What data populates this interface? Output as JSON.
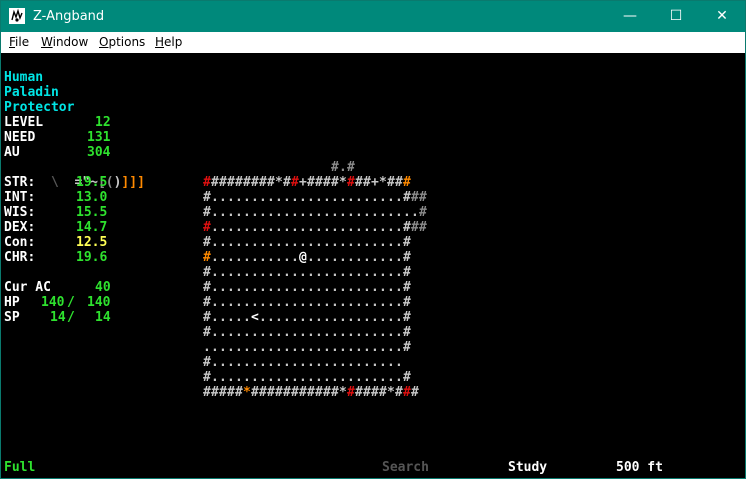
{
  "window": {
    "title": "Z-Angband",
    "minimize": "—",
    "maximize": "☐",
    "close": "✕"
  },
  "menu": {
    "file": {
      "accel": "F",
      "rest": "ile"
    },
    "window": {
      "accel": "W",
      "rest": "indow"
    },
    "options": {
      "accel": "O",
      "rest": "ptions"
    },
    "help": {
      "accel": "H",
      "rest": "elp"
    }
  },
  "character": {
    "race": "Human",
    "class": "Paladin",
    "title": "Protector",
    "level_label": "LEVEL",
    "level": "12",
    "need_label": "NEED",
    "need": "131",
    "au_label": "AU",
    "au": "304"
  },
  "equipment": {
    "chars": [
      "\\",
      " ",
      " ",
      "=",
      "\"",
      "~",
      "[",
      "(",
      ")",
      "]",
      "]",
      "]"
    ]
  },
  "stats": [
    {
      "label": "STR:",
      "value": "19.5",
      "color": "#2ee22e"
    },
    {
      "label": "INT:",
      "value": "13.0",
      "color": "#2ee22e"
    },
    {
      "label": "WIS:",
      "value": "15.5",
      "color": "#2ee22e"
    },
    {
      "label": "DEX:",
      "value": "14.7",
      "color": "#2ee22e"
    },
    {
      "label": "Con:",
      "value": "12.5",
      "color": "#ffff55"
    },
    {
      "label": "CHR:",
      "value": "19.6",
      "color": "#2ee22e"
    }
  ],
  "combat": {
    "ac_label": "Cur AC",
    "ac": "40",
    "hp_label": "HP",
    "hp_cur": "140",
    "hp_sep": "/",
    "hp_max": "140",
    "sp_label": "SP",
    "sp_cur": "14",
    "sp_sep": "/",
    "sp_max": "14"
  },
  "status": {
    "hunger": "Full",
    "search": "Search",
    "study": "Study",
    "depth": "500 ft"
  },
  "map": {
    "palette": {
      "w": "#c8c8c8",
      "r": "#e01010",
      "o": "#ff8a00",
      "g": "#8c8c8c",
      "W": "#ffffff"
    },
    "rows": [
      {
        "text": "                #.#      ",
        "colors": "                ggg      "
      },
      {
        "text": "#########*##+####*###+*###",
        "colors": "rwwwwwwwwwwrwwwwwwrwwwwwwowww"
      },
      {
        "text": "#........................###",
        "colors": "wwwwwwwwwwwwwwwwwwwwwwwwwwggg"
      },
      {
        "text": "#..........................#",
        "colors": "wwwwwwwwwwwwwwwwwwwwwwwwwwwgg"
      },
      {
        "text": "#........................###",
        "colors": "rwwwwwwwwwwwwwwwwwwwwwwwwwggg"
      },
      {
        "text": "#........................#",
        "colors": "wwwwwwwwwwwwwwwwwwwwwwwwwwr"
      },
      {
        "text": "#...........@............#",
        "colors": "owwwwwwwwwwwWwwwwwwwwwwwwwww"
      },
      {
        "text": "#........................#",
        "colors": "wwwwwwwwwwwwwwwwwwwwwwwwwwww"
      },
      {
        "text": "#........................#",
        "colors": "wwwwwwwwwwwwwwwwwwwwwwwwwwr"
      },
      {
        "text": "#........................#",
        "colors": "wwwwwwwwwwwwwwwwwwwwwwwwwwww"
      },
      {
        "text": "#.....<..................#",
        "colors": "wwwwwwWwwwwwwwwwwwwwwwwwwwww"
      },
      {
        "text": "#........................#",
        "colors": "wwwwwwwwwwwwwwwwwwwwwwwwwwww"
      },
      {
        "text": ".........................#",
        "colors": "wwwwwwwwwwwwwwwwwwwwwwwwwwww"
      },
      {
        "text": "#........................",
        "colors": "wwwwwwwwwwwwwwwwwwwwwwwwwwww"
      },
      {
        "text": "#........................#",
        "colors": "wwwwwwwwwwwwwwwwwwwwwwwwwwww"
      },
      {
        "text": "#####*###########*#####*###",
        "colors": "wwwwwowwwwwwwwwwwwrwwwwwwrwww"
      }
    ]
  }
}
